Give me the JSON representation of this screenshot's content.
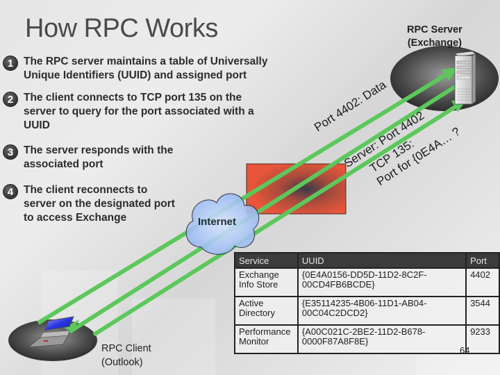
{
  "slide": {
    "title": "How RPC Works",
    "page_number": "64"
  },
  "steps": [
    {
      "number": "1",
      "text": "The RPC server maintains a table of Universally\nUnique Identifiers (UUID) and assigned port"
    },
    {
      "number": "2",
      "text": "The client connects to TCP port 135 on the\nserver to query for the port associated with a\nUUID"
    },
    {
      "number": "3",
      "text": "The server responds with the\nassociated port"
    },
    {
      "number": "4",
      "text": "The client reconnects to\nserver on the designated port\nto access Exchange"
    }
  ],
  "diagram": {
    "server_label": "RPC Server\n(Exchange)",
    "client_label": "RPC Client\n(Outlook)",
    "cloud_label": "Internet",
    "firewall_icon": "firewall-block",
    "server_icon": "server-tower",
    "client_icon": "laptop",
    "cloud_icon": "cloud",
    "arrow_color": "#5cc85c",
    "firewall_color": "#e8553a",
    "arrows": [
      {
        "label": "Port 4402: Data",
        "direction": "client-to-server"
      },
      {
        "label": "Server: Port 4402",
        "direction": "server-to-client"
      },
      {
        "label": "TCP 135:\nPort for {0E4A… ?",
        "label_line1": "TCP 135:",
        "label_line2": "Port for {0E4A… ?",
        "direction": "client-to-server"
      }
    ]
  },
  "table": {
    "headers": [
      "Service",
      "UUID",
      "Port"
    ],
    "rows": [
      {
        "service": "Exchange\nInfo Store",
        "uuid": "{0E4A0156-DD5D-11D2-8C2F-\n00CD4FB6BCDE}",
        "port": "4402"
      },
      {
        "service": "Active\nDirectory",
        "uuid": "{E35114235-4B06-11D1-AB04-\n00C04C2DCD2}",
        "port": "3544"
      },
      {
        "service": "Performance\nMonitor",
        "uuid": "{A00C021C-2BE2-11D2-B678-\n0000F87A8F8E}",
        "port": "9233"
      }
    ]
  }
}
